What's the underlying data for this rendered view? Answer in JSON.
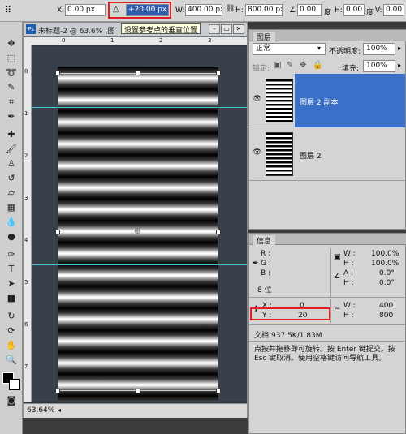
{
  "options_bar": {
    "x_label": "X:",
    "x_value": "0.00 px",
    "y_value": "+20.00 px",
    "w_label": "W:",
    "w_value": "400.00 px",
    "h_label": "H:",
    "h_value": "800.00 px",
    "angle_value": "0.00",
    "angle_unit": "度",
    "hskew_label": "H:",
    "hskew_value": "0.00",
    "hskew_unit": "度",
    "vskew_label": "V:",
    "vskew_value": "0.00",
    "vskew_unit": "度"
  },
  "document": {
    "title": "未标题-2 @ 63.6% (图",
    "tooltip": "设置参考点的垂直位置",
    "zoom": "63.64%",
    "ruler_marks_top": [
      "0",
      "1",
      "2",
      "3"
    ],
    "ruler_marks_left": [
      "0",
      "1",
      "2",
      "3",
      "4",
      "5",
      "6",
      "7"
    ]
  },
  "layers_panel": {
    "tab": "图层",
    "blend_mode": "正常",
    "opacity_label": "不透明度:",
    "opacity_value": "100%",
    "lock_label": "锁定:",
    "fill_label": "填充:",
    "fill_value": "100%",
    "layers": [
      {
        "name": "图层 2 副本",
        "selected": true
      },
      {
        "name": "图层 2",
        "selected": false
      }
    ]
  },
  "info_panel": {
    "tab": "信息",
    "r_label": "R :",
    "g_label": "G :",
    "b_label": "B :",
    "bit_depth": "8 位",
    "w_label": "W :",
    "w_value": "100.0%",
    "h_label": "H :",
    "h_value": "100.0%",
    "a_label": "A :",
    "a_value": "0.0°",
    "h2_label": "H :",
    "h2_value": "0.0°",
    "x_label": "X :",
    "x_value": "0",
    "y_label": "Y :",
    "y_value": "20",
    "w2_label": "W :",
    "w2_value": "400",
    "h3_label": "H :",
    "h3_value": "800",
    "doc_size": "文档:937.5K/1.83M",
    "hint": "点按并拖移即可旋转。按 Enter 键提交。按 Esc 键取消。使用空格键访问导航工具。"
  },
  "colors": {
    "selection_blue": "#3a70c8",
    "guide_cyan": "#3ec9d6",
    "highlight_red": "#e02020"
  }
}
